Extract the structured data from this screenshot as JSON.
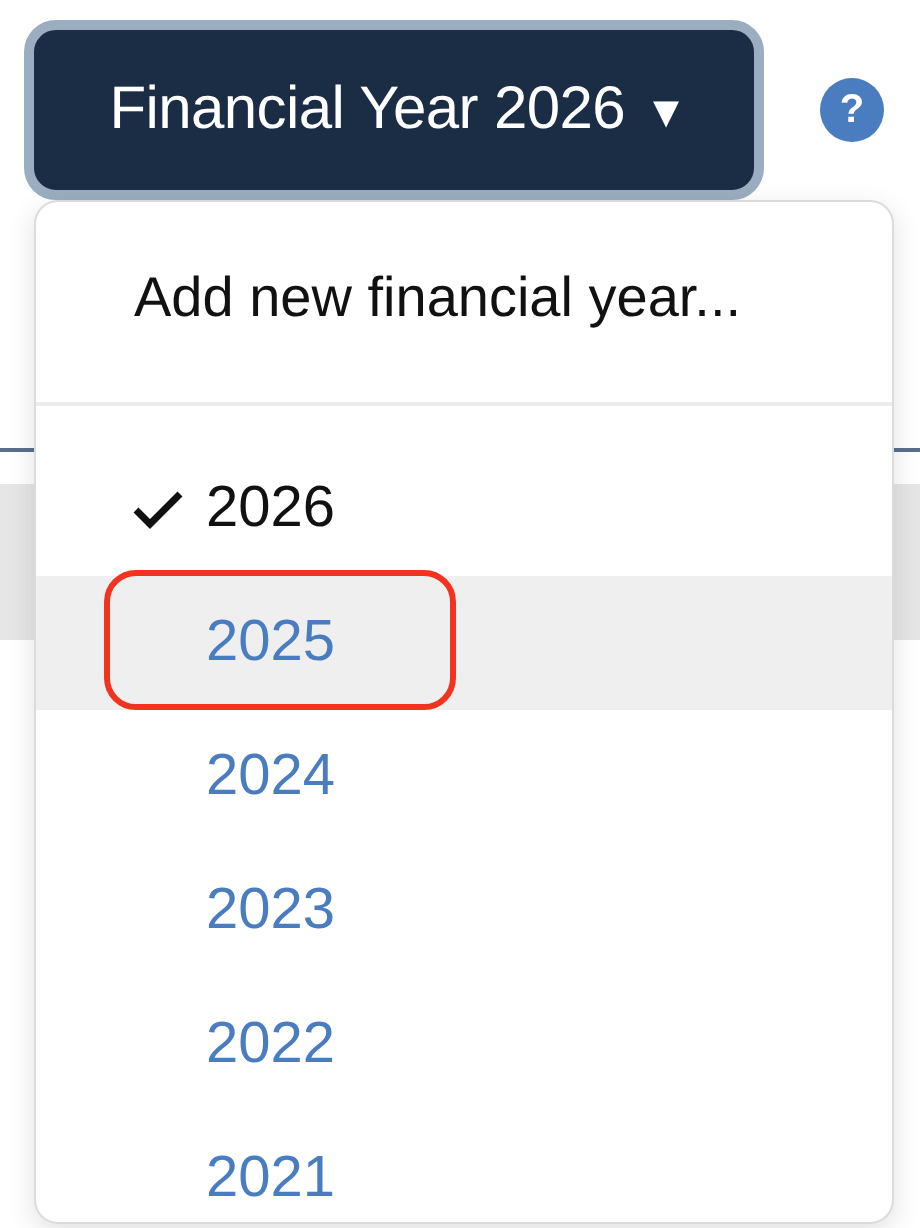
{
  "year_button": {
    "label": "Financial Year 2026",
    "caret": "▾"
  },
  "help": {
    "label": "?"
  },
  "menu": {
    "add_item": "Add new financial year...",
    "years": [
      {
        "label": "2026",
        "selected": true,
        "highlighted": false,
        "circled": false
      },
      {
        "label": "2025",
        "selected": false,
        "highlighted": true,
        "circled": true
      },
      {
        "label": "2024",
        "selected": false,
        "highlighted": false,
        "circled": false
      },
      {
        "label": "2023",
        "selected": false,
        "highlighted": false,
        "circled": false
      },
      {
        "label": "2022",
        "selected": false,
        "highlighted": false,
        "circled": false
      },
      {
        "label": "2021",
        "selected": false,
        "highlighted": false,
        "circled": false
      }
    ]
  }
}
